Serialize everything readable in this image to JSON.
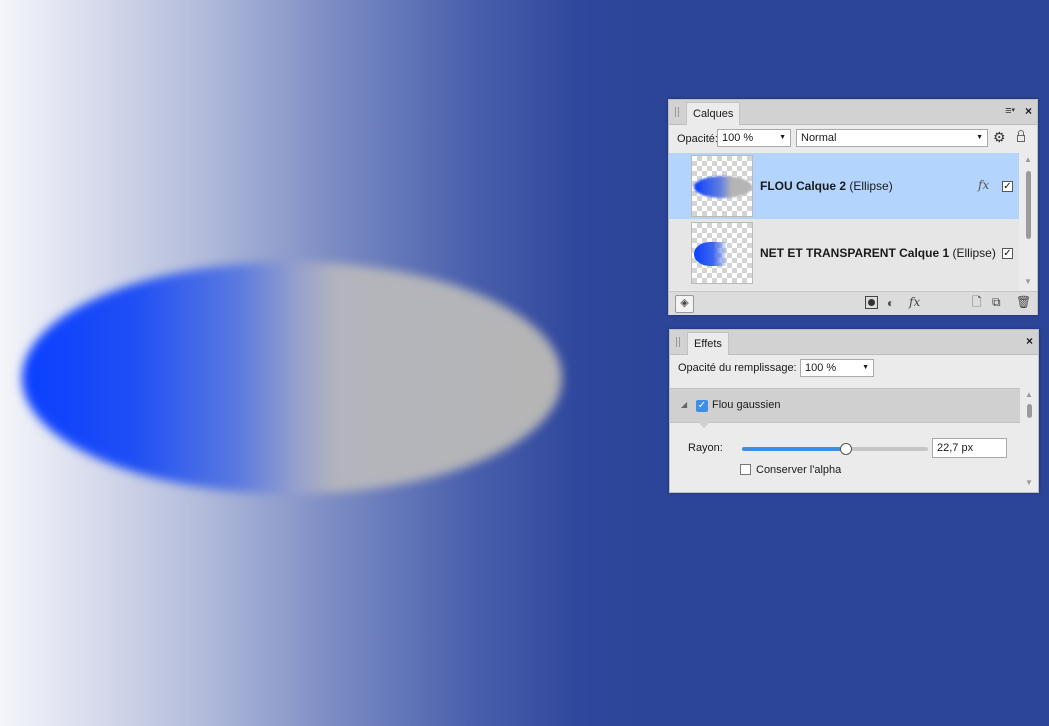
{
  "canvas": {
    "description_colors": {
      "ellipse_left": "#0a3fff",
      "ellipse_right": "#b5b5b5",
      "background_right": "#2c4599"
    }
  },
  "layers_panel": {
    "tab_label": "Calques",
    "opacity_label": "Opacité:",
    "opacity_value": "100 %",
    "blend_mode": "Normal",
    "layers": [
      {
        "name_bold": "FLOU Calque 2",
        "name_type": "(Ellipse)",
        "has_fx": true,
        "visible": true,
        "selected": true
      },
      {
        "name_bold": "NET ET TRANSPARENT Calque 1",
        "name_type": "(Ellipse)",
        "has_fx": false,
        "visible": true,
        "selected": false
      }
    ],
    "fx_label": "fx",
    "footer_fx_label": "fx",
    "accent_color": "#b3d4fc"
  },
  "effects_panel": {
    "tab_label": "Effets",
    "fill_opacity_label": "Opacité du remplissage:",
    "fill_opacity_value": "100 %",
    "effect_name": "Flou gaussien",
    "effect_enabled": true,
    "radius_label": "Rayon:",
    "radius_value": "22,7 px",
    "radius_fraction": 0.56,
    "preserve_alpha_label": "Conserver l'alpha",
    "preserve_alpha_checked": false
  }
}
